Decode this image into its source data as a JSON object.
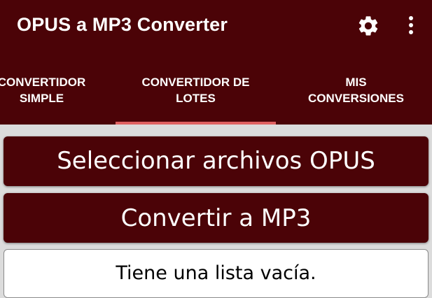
{
  "app": {
    "title": "OPUS a MP3 Converter",
    "brand_color": "#4b0307",
    "accent_color": "#e06060"
  },
  "toolbar": {
    "settings_icon": "gear-icon",
    "more_icon": "more-vert-icon"
  },
  "tabs": [
    {
      "line1": "CONVERTIDOR",
      "line2": "SIMPLE",
      "selected": false
    },
    {
      "line1": "CONVERTIDOR DE",
      "line2": "LOTES",
      "selected": true
    },
    {
      "line1": "MIS",
      "line2": "CONVERSIONES",
      "selected": false
    }
  ],
  "main": {
    "select_button": "Seleccionar archivos OPUS",
    "convert_button": "Convertir a MP3",
    "empty_message": "Tiene una lista vacía."
  }
}
